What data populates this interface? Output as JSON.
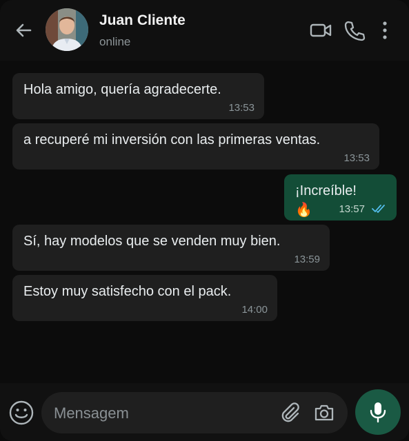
{
  "header": {
    "contact_name": "Juan Cliente",
    "status": "online",
    "icons": [
      "back-arrow-icon",
      "video-call-icon",
      "phone-icon",
      "more-vert-icon"
    ]
  },
  "messages": [
    {
      "direction": "in",
      "text": "Hola amigo, quería agradecerte.",
      "time": "13:53"
    },
    {
      "direction": "in",
      "text": "a recuperé mi inversión con las primeras ventas.",
      "time": "13:53"
    },
    {
      "direction": "out",
      "text": "¡Increíble!",
      "emoji": "🔥",
      "time": "13:57",
      "read": true
    },
    {
      "direction": "in",
      "text": "Sí, hay modelos que se venden muy bien.",
      "time": "13:59"
    },
    {
      "direction": "in",
      "text": "Estoy muy satisfecho con el pack.",
      "time": "14:00"
    }
  ],
  "composer": {
    "placeholder": "Mensagem",
    "icons": [
      "emoji-icon",
      "attach-icon",
      "camera-icon",
      "mic-icon"
    ]
  },
  "colors": {
    "background": "#0a0a0a",
    "incoming_bubble": "#1f1f1f",
    "outgoing_bubble": "#134d37",
    "read_ticks": "#53bdeb",
    "mic_button": "#1a5a44"
  }
}
